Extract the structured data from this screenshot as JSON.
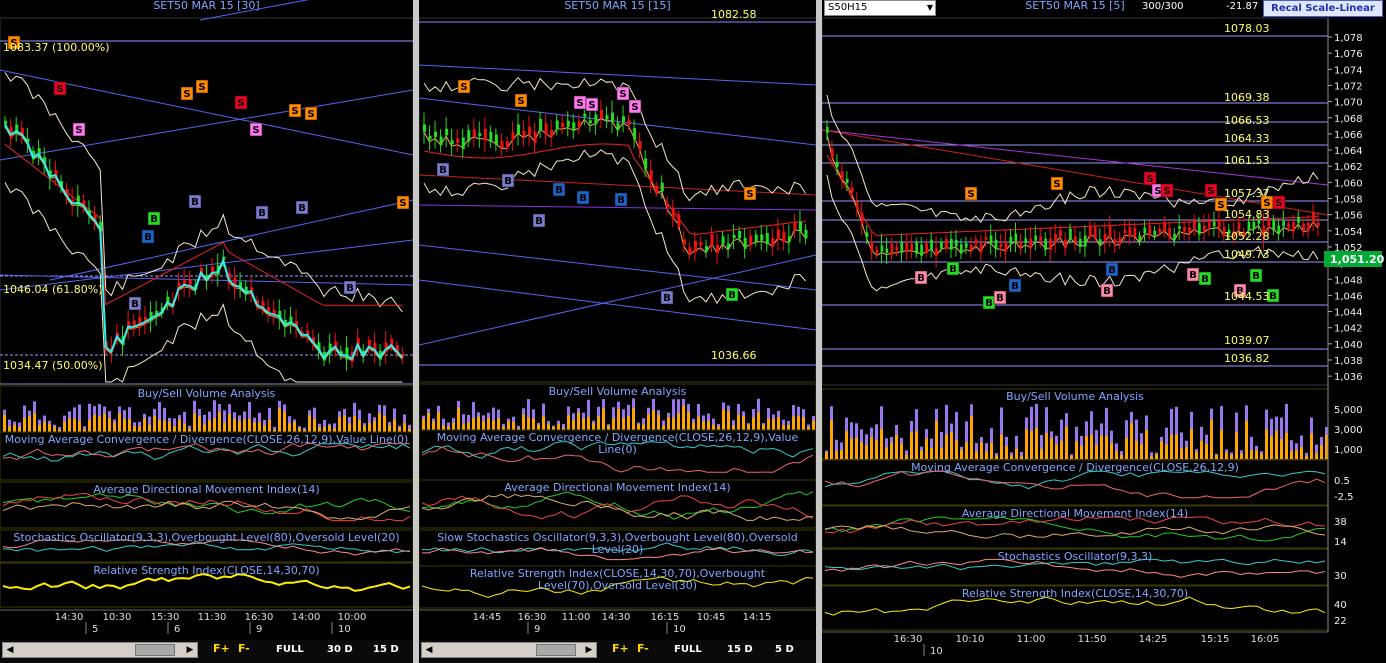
{
  "panels": [
    {
      "title": "SET50 MAR 15  [30]",
      "fib_labels": [
        {
          "text": "1083.37 (100.00%)",
          "price": 1083.37
        },
        {
          "text": "1046.04 (61.80%)",
          "price": 1046.04
        },
        {
          "text": "1034.47 (50.00%)",
          "price": 1034.47
        }
      ],
      "indicators": [
        "Buy/Sell Volume Analysis",
        "Moving Average Convergence / Divergence(CLOSE,26,12,9),Value Line(0)",
        "Average Directional Movement Index(14)",
        "Stochastics Oscillator(9,3,3),Overbought Level(80),Oversold Level(20)",
        "Relative Strength Index(CLOSE,14,30,70)"
      ],
      "time_labels": [
        "14:30",
        "10:30",
        "15:30",
        "11:30",
        "16:30",
        "14:00",
        "10:00"
      ],
      "date_labels": [
        "5",
        "6",
        "9",
        "10"
      ],
      "toolbar": {
        "full": "FULL",
        "b1": "30 D",
        "b2": "15 D",
        "f_plus": "F+",
        "f_minus": "F-"
      }
    },
    {
      "title": "SET50 MAR 15  [15]",
      "price_labels": [
        {
          "text": "1082.58"
        },
        {
          "text": "1036.66"
        }
      ],
      "indicators": [
        "Buy/Sell Volume Analysis",
        "Moving Average Convergence / Divergence(CLOSE,26,12,9),Value Line(0)",
        "Average Directional Movement Index(14)",
        "Slow Stochastics Oscillator(9,3,3),Overbought Level(80),Oversold Level(20)",
        "Relative Strength Index(CLOSE,14,30,70),Overbought Level(70),Oversold Level(30)"
      ],
      "time_labels": [
        "14:45",
        "16:30",
        "11:00",
        "14:30",
        "16:15",
        "10:45",
        "14:15"
      ],
      "date_labels": [
        "9",
        "10"
      ],
      "toolbar": {
        "full": "FULL",
        "b1": "15 D",
        "b2": "5 D",
        "f_plus": "F+",
        "f_minus": "F-"
      }
    },
    {
      "title": "SET50 MAR 15  [5]",
      "symbol": "S50H15",
      "counts": "300/300",
      "change": "-21.87",
      "recal_label": "Recal Scale-Linear",
      "last_price": "1,051.20",
      "price_labels": [
        "1078.03",
        "1069.38",
        "1066.53",
        "1064.33",
        "1061.53",
        "1057.37",
        "1054.83",
        "1052.28",
        "1049.73",
        "1044.53",
        "1039.07",
        "1036.82"
      ],
      "y_ticks": [
        "1,078",
        "1,076",
        "1,074",
        "1,072",
        "1,070",
        "1,068",
        "1,066",
        "1,064",
        "1,062",
        "1,060",
        "1,058",
        "1,056",
        "1,054",
        "1,052",
        "1,050",
        "1,048",
        "1,046",
        "1,044",
        "1,042",
        "1,040",
        "1,038",
        "1,036"
      ],
      "volume_ticks": [
        "5,000",
        "3,000",
        "1,000"
      ],
      "macd_ticks": [
        "0.5",
        "-2.5"
      ],
      "adx_ticks": [
        "38",
        "14"
      ],
      "stoch_ticks": [
        "30"
      ],
      "rsi_ticks": [
        "40",
        "22"
      ],
      "indicators": [
        "Buy/Sell Volume Analysis",
        "Moving Average Convergence / Divergence(CLOSE,26,12,9)",
        "Average Directional Movement Index(14)",
        "Stochastics Oscillator(9,3,3)",
        "Relative Strength Index(CLOSE,14,30,70)"
      ],
      "time_labels": [
        "16:30",
        "10:10",
        "11:00",
        "11:50",
        "14:25",
        "15:15",
        "16:05"
      ],
      "date_labels": [
        "10"
      ]
    }
  ],
  "colors": {
    "title": "#7fa6ff",
    "price_label": "#ffff66",
    "fib_line": "#9999ff",
    "bull": "#22dd22",
    "bear": "#ee1111",
    "sell_orange": "#ff8800",
    "sell_red": "#ee0022",
    "sell_pink": "#ff77ee",
    "buy_blue": "#1a64c8",
    "buy_gray": "#7a7acc",
    "buy_green": "#22dd22",
    "buy_pink": "#ff88aa",
    "vol_buy": "#ffa500",
    "vol_sell": "#9977ee"
  }
}
